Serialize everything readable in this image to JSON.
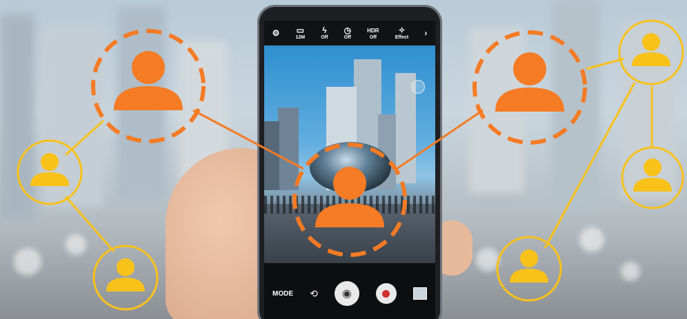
{
  "camera": {
    "top_bar": [
      {
        "icon": "gear-icon",
        "label": ""
      },
      {
        "icon": "resolution-icon",
        "label": "12M"
      },
      {
        "icon": "flash-icon",
        "label": "Off"
      },
      {
        "icon": "timer-icon",
        "label": "Off"
      },
      {
        "icon": "hdr-icon",
        "label": "Off",
        "title": "HDR"
      },
      {
        "icon": "effect-icon",
        "label": "Effect"
      },
      {
        "icon": "chevron-right-icon",
        "label": ""
      }
    ],
    "bottom_bar": {
      "mode_label": "MODE",
      "shutter_icon": "camera-icon",
      "switch_icon": "switch-camera-icon",
      "record_icon": "record-icon",
      "gallery_icon": "gallery-thumbnail"
    },
    "zoom_icon": "zoom-indicator-icon"
  },
  "colors": {
    "orange": "#f57b25",
    "yellow": "#f9c21a",
    "screen_bg": "#0b0c0e",
    "record_red": "#d0312d"
  },
  "overlay_icons": {
    "large_nodes": [
      "user-icon",
      "user-icon",
      "user-icon"
    ],
    "small_nodes": [
      "user-icon",
      "user-icon",
      "user-icon",
      "user-icon"
    ]
  }
}
